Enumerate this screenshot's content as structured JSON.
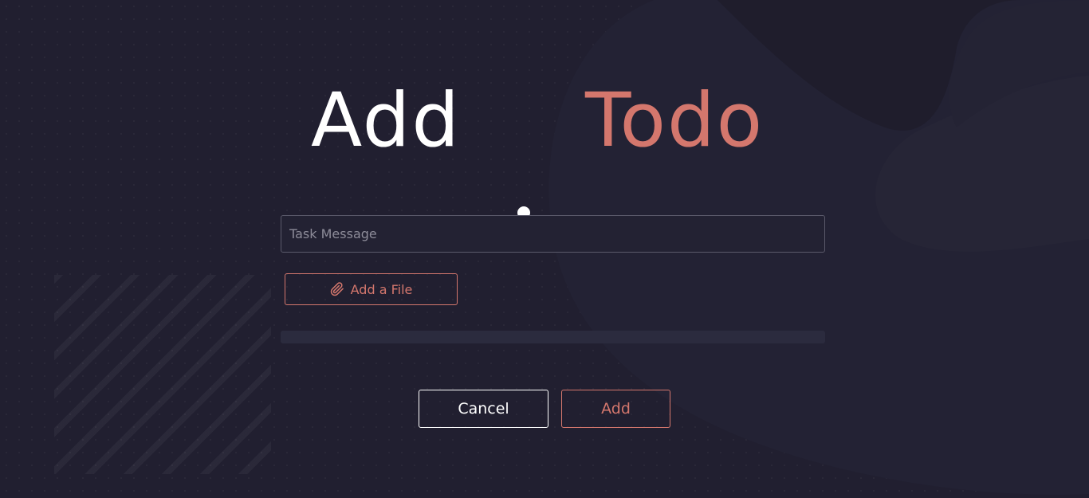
{
  "title": {
    "word1": "Add",
    "word2": "Todo"
  },
  "form": {
    "task_placeholder": "Task Message",
    "task_value": "",
    "file_button_label": "Add a File",
    "file_button_icon": "paperclip-icon",
    "upload_progress": 0
  },
  "actions": {
    "cancel_label": "Cancel",
    "add_label": "Add"
  },
  "colors": {
    "background": "#211f30",
    "accent": "#d4776d",
    "text": "#ffffff",
    "input_border": "#5b5a6b",
    "progress_track": "#2b2b3e"
  }
}
